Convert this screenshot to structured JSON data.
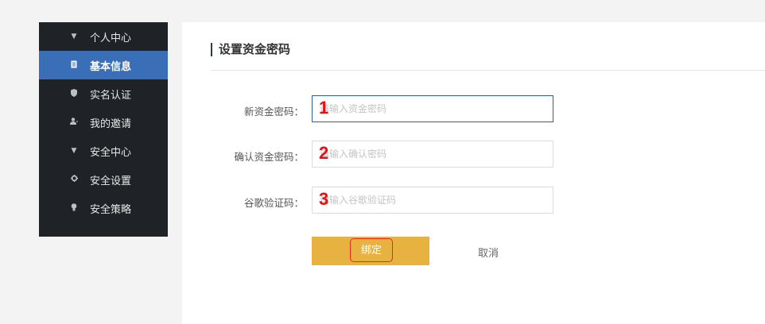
{
  "sidebar": {
    "items": [
      {
        "label": "个人中心",
        "icon": "caret-down-icon"
      },
      {
        "label": "基本信息",
        "icon": "document-icon",
        "active": true
      },
      {
        "label": "实名认证",
        "icon": "shield-icon"
      },
      {
        "label": "我的邀请",
        "icon": "user-add-icon"
      },
      {
        "label": "安全中心",
        "icon": "caret-down-icon"
      },
      {
        "label": "安全设置",
        "icon": "gear-icon"
      },
      {
        "label": "安全策略",
        "icon": "lightbulb-icon"
      }
    ]
  },
  "form": {
    "title": "设置资金密码",
    "fields": [
      {
        "label": "新资金密码：",
        "placeholder": "请输入资金密码",
        "value": "",
        "marker": "1"
      },
      {
        "label": "确认资金密码：",
        "placeholder": "请输入确认密码",
        "value": "",
        "marker": "2"
      },
      {
        "label": "谷歌验证码：",
        "placeholder": "请输入谷歌验证码",
        "value": "",
        "marker": "3"
      }
    ],
    "submit_label": "绑定",
    "cancel_label": "取消"
  },
  "colors": {
    "sidebar_bg": "#1f2226",
    "sidebar_active": "#3a6fb8",
    "submit_bg": "#e8b241",
    "annotation_red": "#e81010"
  }
}
